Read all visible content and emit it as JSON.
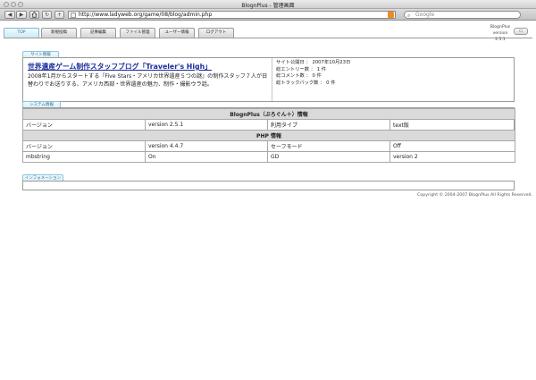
{
  "window": {
    "title": "BlognPlus - 管理画面",
    "url": "http://www.ladyweb.org/game/08/blog/admin.php",
    "search_placeholder": "Google",
    "back_icon": "◀",
    "forward_icon": "▶",
    "reload_icon": "↻",
    "add_icon": "+"
  },
  "nav": {
    "tabs": [
      {
        "label": "TOP",
        "active": true
      },
      {
        "label": "新規投稿"
      },
      {
        "label": "記事編集"
      },
      {
        "label": "ファイル管理"
      },
      {
        "label": "ユーザー情報"
      },
      {
        "label": "ログアウト"
      }
    ]
  },
  "version_badge": {
    "line1": "BlognPlus",
    "line2": "version",
    "line3": "2.5.1"
  },
  "site_info": {
    "tab_label": "サイト情報",
    "title": "世界遺産ゲーム制作スタッフブログ「Traveler's High」",
    "description": "2008年1月からスタートする『Five Stars・アメリカ世界遺産５つの謎』の制作スタッフ７人が日替わりでお送りする、アメリカ西部・世界遺産の魅力、制作・撮影ウラ話。",
    "stats": [
      "サイト公開日 ： 2007年10月23日",
      "総エントリー数 ： 1 件",
      "総コメント数 ： 0 件",
      "総トラックバック数 ： 0 件"
    ]
  },
  "system_info": {
    "tab_label": "システム情報",
    "blogn_header": "BlognPlus（ぶろぐん＋）情報",
    "blogn_row": {
      "k1": "バージョン",
      "v1": "version 2.5.1",
      "k2": "利用タイプ",
      "v2": "text版"
    },
    "php_header": "PHP 情報",
    "php_rows": [
      {
        "k1": "バージョン",
        "v1": "version 4.4.7",
        "k2": "セーフモード",
        "v2": "Off"
      },
      {
        "k1": "mbstring",
        "v1": "On",
        "k2": "GD",
        "v2": "version 2"
      }
    ]
  },
  "information": {
    "tab_label": "インフォメーション"
  },
  "footer": {
    "copyright": "Copyright © 2004-2007 BlognPlus All Rights Reserved."
  }
}
